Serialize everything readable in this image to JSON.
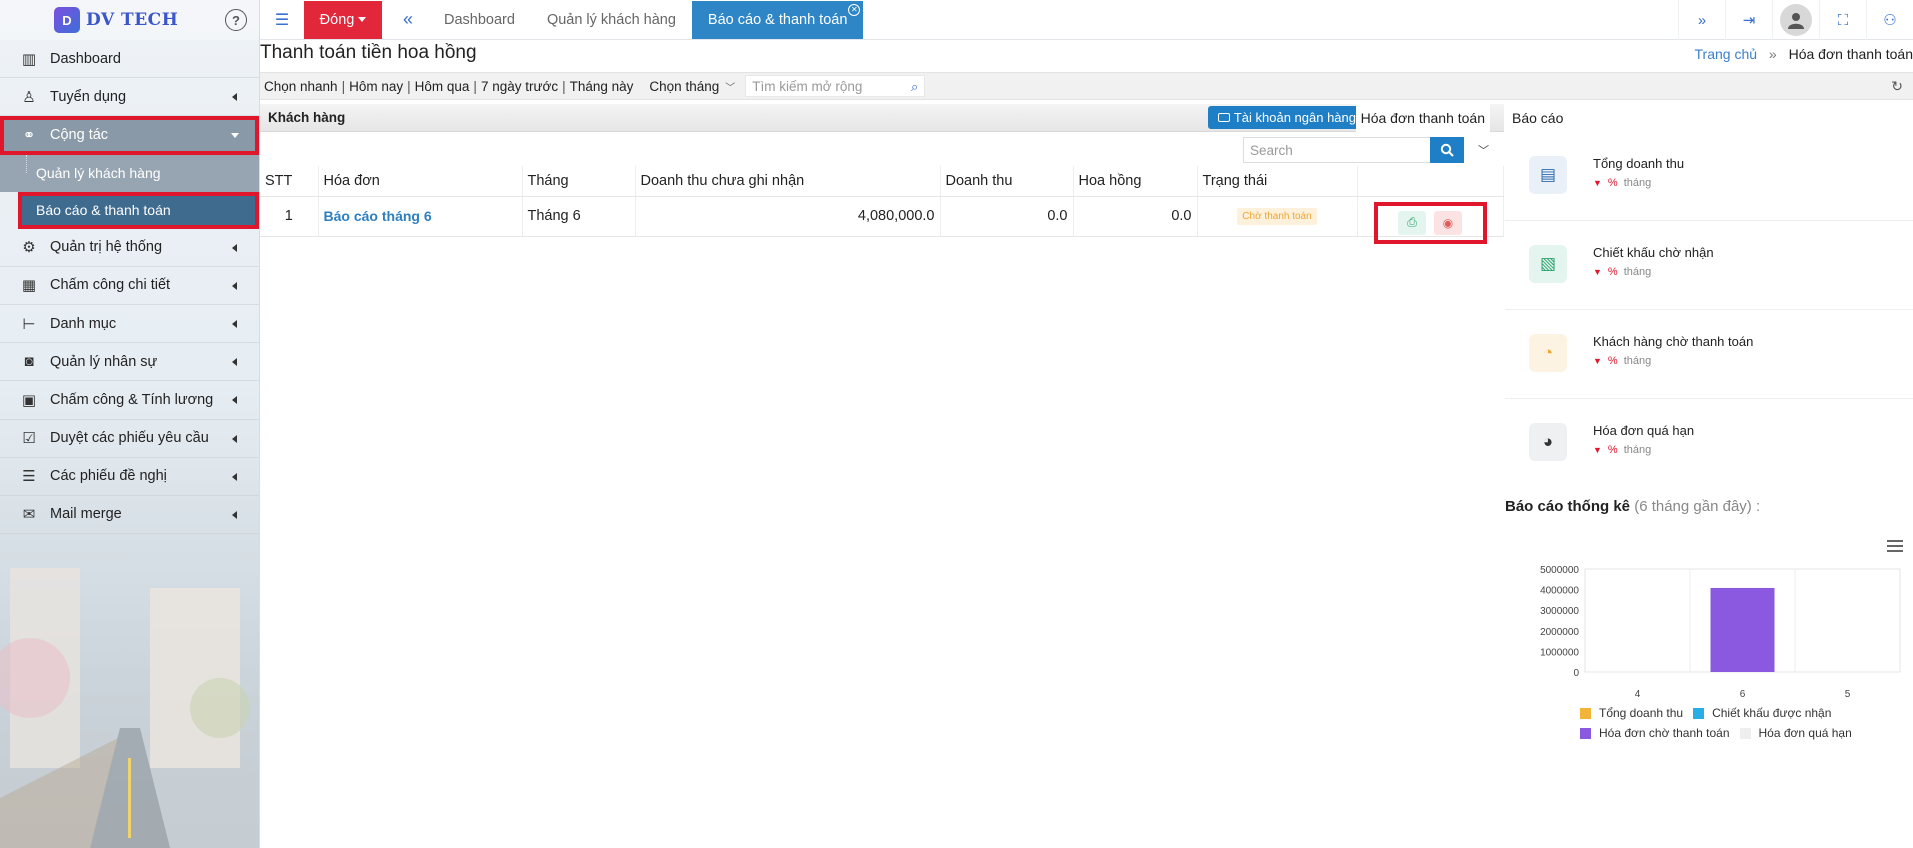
{
  "brand": {
    "logo_text": "DV TECH",
    "logo_letter": "D"
  },
  "sidebar": {
    "items": [
      {
        "label": "Dashboard",
        "icon": "bar-chart-icon",
        "glyph": "▥",
        "has_caret": false
      },
      {
        "label": "Tuyển dụng",
        "icon": "user-icon",
        "glyph": "♙",
        "has_caret": true
      },
      {
        "label": "Cộng tác",
        "icon": "handshake-icon",
        "glyph": "⚭",
        "has_caret": true,
        "active": true
      },
      {
        "label": "Quản trị hệ thống",
        "icon": "gear-icon",
        "glyph": "⚙",
        "has_caret": true
      },
      {
        "label": "Chấm công chi tiết",
        "icon": "calendar-icon",
        "glyph": "▦",
        "has_caret": true
      },
      {
        "label": "Danh mục",
        "icon": "tree-icon",
        "glyph": "⊢",
        "has_caret": true
      },
      {
        "label": "Quản lý nhân sự",
        "icon": "id-card-icon",
        "glyph": "◙",
        "has_caret": true
      },
      {
        "label": "Chấm công & Tính lương",
        "icon": "contact-card-icon",
        "glyph": "▣",
        "has_caret": true
      },
      {
        "label": "Duyệt các phiếu yêu cầu",
        "icon": "checklist-icon",
        "glyph": "☑",
        "has_caret": true
      },
      {
        "label": "Các phiếu đề nghị",
        "icon": "list-icon",
        "glyph": "☰",
        "has_caret": true
      },
      {
        "label": "Mail merge",
        "icon": "mail-icon",
        "glyph": "✉",
        "has_caret": true
      }
    ],
    "sub_items": [
      "Quản lý khách hàng",
      "Báo cáo & thanh toán"
    ]
  },
  "topbar": {
    "close_label": "Đóng",
    "tabs": [
      "Dashboard",
      "Quản lý khách hàng",
      "Báo cáo & thanh toán"
    ]
  },
  "page": {
    "title": "Thanh toán tiền hoa hồng",
    "breadcrumb_home": "Trang chủ",
    "breadcrumb_current": "Hóa đơn thanh toán"
  },
  "filters": {
    "quick": "Chọn nhanh",
    "today": "Hôm nay",
    "yesterday": "Hôm qua",
    "last7": "7 ngày trước",
    "this_month": "Tháng này",
    "choose_month": "Chọn tháng",
    "search_placeholder": "Tìm kiếm mở rộng"
  },
  "panel": {
    "title": "Khách hàng",
    "bank_button": "Tài khoản ngân hàng",
    "tab_invoice": "Hóa đơn thanh toán",
    "tab_report": "Báo cáo",
    "search_placeholder": "Search"
  },
  "table": {
    "headers": [
      "STT",
      "Hóa đơn",
      "Tháng",
      "Doanh thu chưa ghi nhận",
      "Doanh thu",
      "Hoa hồng",
      "Trạng thái"
    ],
    "rows": [
      {
        "stt": "1",
        "invoice": "Báo cáo tháng 6",
        "month": "Tháng 6",
        "unrecorded": "4,080,000.0",
        "revenue": "0.0",
        "commission": "0.0",
        "status": "Chờ thanh toán"
      }
    ]
  },
  "kpis": [
    {
      "label": "Tổng doanh thu",
      "pct": "%",
      "period": "tháng",
      "icon": "invoice-icon",
      "bg": "#e9f0f8",
      "fg": "#2e6ab0"
    },
    {
      "label": "Chiết khấu chờ nhận",
      "pct": "%",
      "period": "tháng",
      "icon": "document-icon",
      "bg": "#e4f4ee",
      "fg": "#29a36b"
    },
    {
      "label": "Khách hàng chờ thanh toán",
      "pct": "%",
      "period": "tháng",
      "icon": "pie-icon",
      "bg": "#fdf3e2",
      "fg": "#f0a632"
    },
    {
      "label": "Hóa đơn quá hạn",
      "pct": "%",
      "period": "tháng",
      "icon": "pie-dark-icon",
      "bg": "#eef0f2",
      "fg": "#333333"
    }
  ],
  "chart_header": {
    "title": "Báo cáo thống kê",
    "subtitle": "(6 tháng gần đây) :"
  },
  "chart_data": {
    "type": "bar",
    "categories": [
      "4",
      "6",
      "5"
    ],
    "ylim": [
      0,
      5000000
    ],
    "yticks": [
      "5000000",
      "4000000",
      "3000000",
      "2000000",
      "1000000",
      "0"
    ],
    "series": [
      {
        "name": "Tổng doanh thu",
        "color": "#f2b53a",
        "values": [
          0,
          0,
          0
        ]
      },
      {
        "name": "Chiết khấu được nhận",
        "color": "#27aee6",
        "values": [
          0,
          0,
          0
        ]
      },
      {
        "name": "Hóa đơn chờ thanh toán",
        "color": "#8a59e0",
        "values": [
          0,
          4080000,
          0
        ]
      },
      {
        "name": "Hóa đơn quá hạn",
        "color": "#eeeeee",
        "values": [
          0,
          0,
          0
        ]
      }
    ],
    "legend": "bottom"
  }
}
